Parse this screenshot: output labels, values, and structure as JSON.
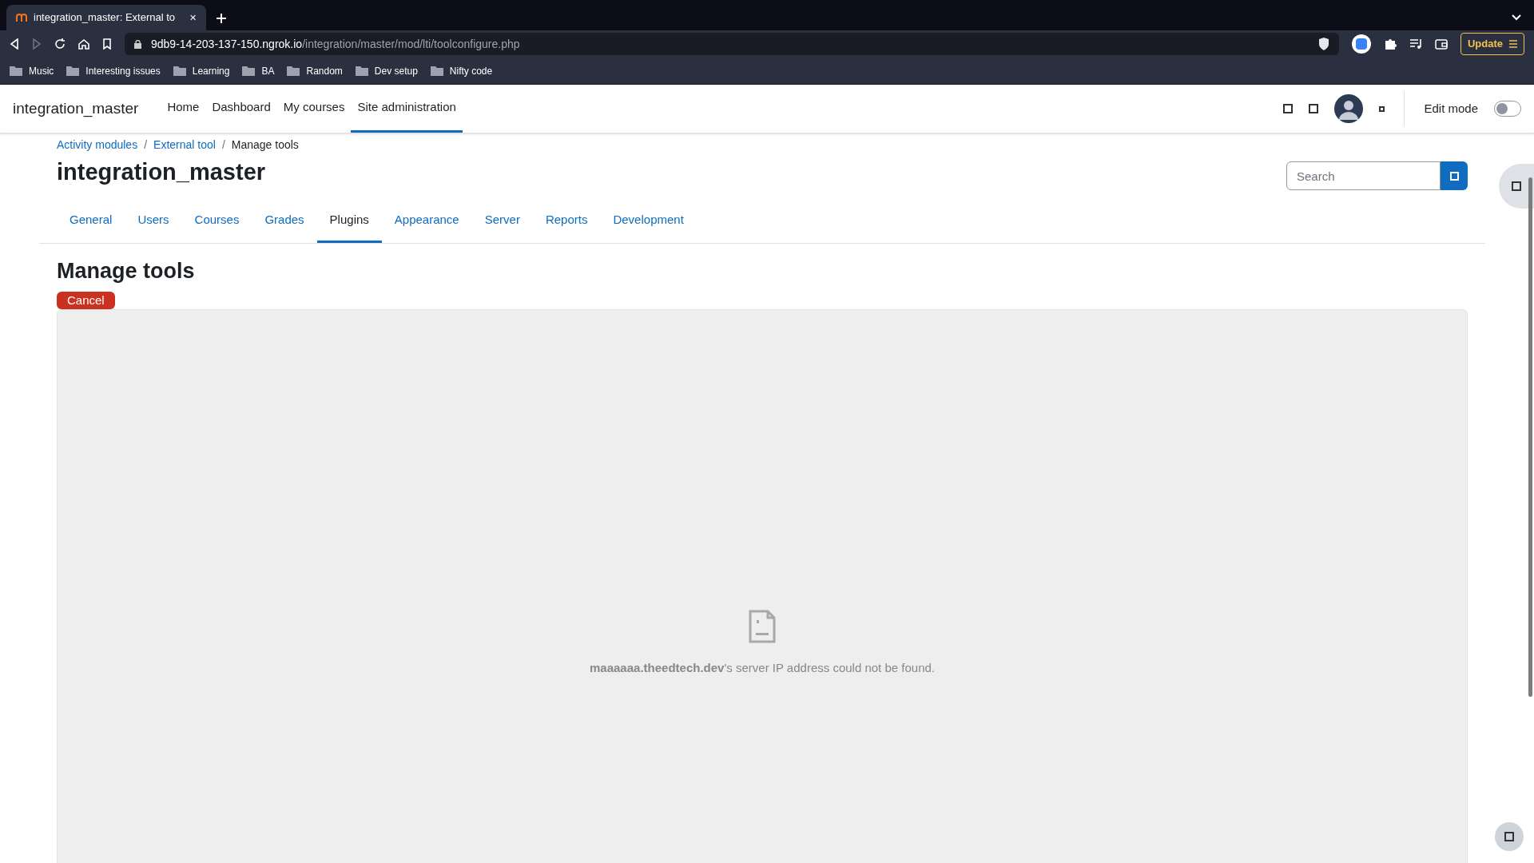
{
  "browser": {
    "tab": {
      "title": "integration_master: External to",
      "close": "✕",
      "selected": true
    },
    "address": {
      "host": "9db9-14-203-137-150.ngrok.io",
      "path": "/integration/master/mod/lti/toolconfigure.php"
    },
    "update_button": "Update",
    "bookmarks": [
      "Music",
      "Interesting issues",
      "Learning",
      "BA",
      "Random",
      "Dev setup",
      "Nifty code"
    ]
  },
  "navbar": {
    "site_name": "integration_master",
    "items": [
      {
        "label": "Home",
        "selected": false
      },
      {
        "label": "Dashboard",
        "selected": false
      },
      {
        "label": "My courses",
        "selected": false
      },
      {
        "label": "Site administration",
        "selected": true
      }
    ],
    "edit_mode": {
      "label": "Edit mode",
      "on": false
    }
  },
  "breadcrumb": [
    "Activity modules",
    "External tool",
    "Manage tools"
  ],
  "breadcrumb_separators": [
    "/",
    "/"
  ],
  "heading": "integration_master",
  "search": {
    "placeholder": "Search"
  },
  "admin_tabs": [
    {
      "label": "General",
      "selected": false
    },
    {
      "label": "Users",
      "selected": false
    },
    {
      "label": "Courses",
      "selected": false
    },
    {
      "label": "Grades",
      "selected": false
    },
    {
      "label": "Plugins",
      "selected": true
    },
    {
      "label": "Appearance",
      "selected": false
    },
    {
      "label": "Server",
      "selected": false
    },
    {
      "label": "Reports",
      "selected": false
    },
    {
      "label": "Development",
      "selected": false
    }
  ],
  "page_title": "Manage tools",
  "cancel_button": "Cancel",
  "frame_error": {
    "message": "**maaaaaa.theedtech.dev**'s server IP address could not be found."
  }
}
